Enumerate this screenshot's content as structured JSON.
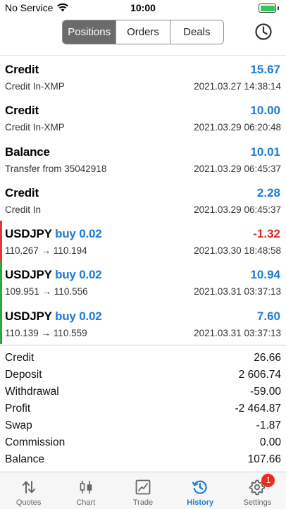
{
  "status_bar": {
    "carrier": "No Service",
    "time": "10:00"
  },
  "segments": [
    {
      "label": "Positions",
      "active": true
    },
    {
      "label": "Orders",
      "active": false
    },
    {
      "label": "Deals",
      "active": false
    }
  ],
  "rows": [
    {
      "title": "Credit",
      "side": "",
      "value": "15.67",
      "subtitle": "Credit In-XMP",
      "date": "2021.03.27 14:38:14",
      "value_color": "blue",
      "stripe": ""
    },
    {
      "title": "Credit",
      "side": "",
      "value": "10.00",
      "subtitle": "Credit In-XMP",
      "date": "2021.03.29 06:20:48",
      "value_color": "blue",
      "stripe": ""
    },
    {
      "title": "Balance",
      "side": "",
      "value": "10.01",
      "subtitle": "Transfer from 35042918",
      "date": "2021.03.29 06:45:37",
      "value_color": "blue",
      "stripe": ""
    },
    {
      "title": "Credit",
      "side": "",
      "value": "2.28",
      "subtitle": "Credit In",
      "date": "2021.03.29 06:45:37",
      "value_color": "blue",
      "stripe": ""
    },
    {
      "title": "USDJPY",
      "side": "buy 0.02",
      "value": "-1.32",
      "subtitle": "110.267 → 110.194",
      "date": "2021.03.30 18:48:58",
      "value_color": "red",
      "stripe": "red"
    },
    {
      "title": "USDJPY",
      "side": "buy 0.02",
      "value": "10.94",
      "subtitle": "109.951 → 110.556",
      "date": "2021.03.31 03:37:13",
      "value_color": "blue",
      "stripe": "green"
    },
    {
      "title": "USDJPY",
      "side": "buy 0.02",
      "value": "7.60",
      "subtitle": "110.139 → 110.559",
      "date": "2021.03.31 03:37:13",
      "value_color": "blue",
      "stripe": "green"
    }
  ],
  "summary": [
    {
      "label": "Credit",
      "value": "26.66"
    },
    {
      "label": "Deposit",
      "value": "2 606.74"
    },
    {
      "label": "Withdrawal",
      "value": "-59.00"
    },
    {
      "label": "Profit",
      "value": "-2 464.87"
    },
    {
      "label": "Swap",
      "value": "-1.87"
    },
    {
      "label": "Commission",
      "value": "0.00"
    },
    {
      "label": "Balance",
      "value": "107.66"
    }
  ],
  "tabs": [
    {
      "label": "Quotes",
      "icon": "quotes-arrows-icon",
      "active": false
    },
    {
      "label": "Chart",
      "icon": "candlestick-chart-icon",
      "active": false
    },
    {
      "label": "Trade",
      "icon": "trade-chart-icon",
      "active": false
    },
    {
      "label": "History",
      "icon": "history-clock-icon",
      "active": true
    },
    {
      "label": "Settings",
      "icon": "gear-icon",
      "active": false,
      "badge": "1"
    }
  ],
  "colors": {
    "accent_blue": "#1e7bd6",
    "negative_red": "#d92b1e",
    "stripe_red": "#e53935",
    "stripe_green": "#2eaa3c",
    "battery_green": "#34c759",
    "badge_red": "#f2281b"
  }
}
